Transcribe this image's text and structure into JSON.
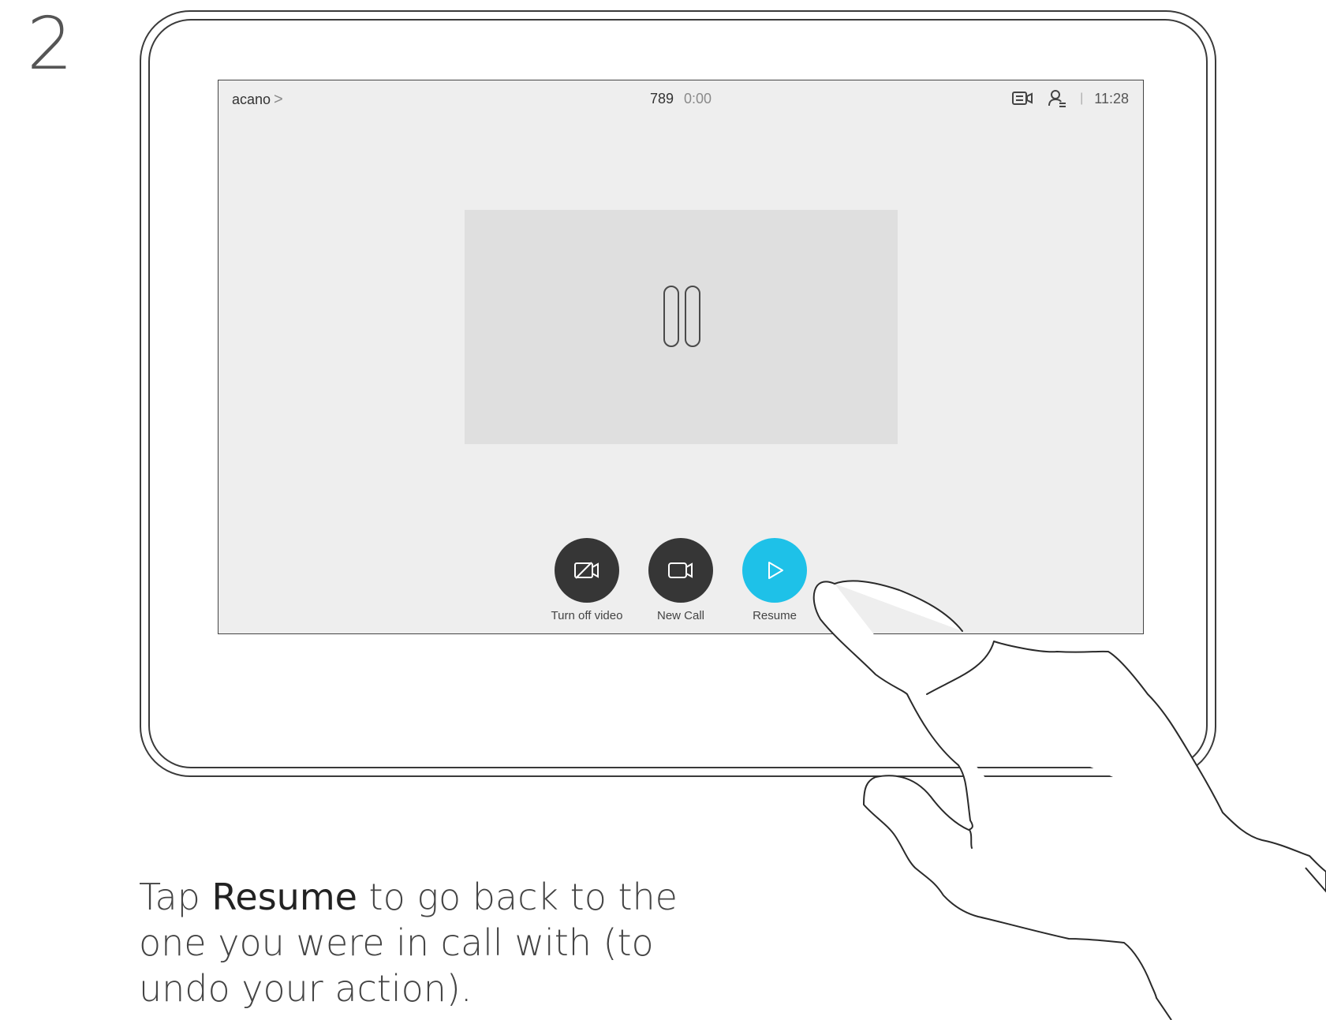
{
  "step": {
    "number": "2"
  },
  "screen": {
    "breadcrumb": {
      "label": "acano",
      "chevron": ">"
    },
    "call": {
      "number": "789",
      "duration": "0:00"
    },
    "status": {
      "separator": "|",
      "time": "11:28"
    },
    "controls": [
      {
        "label": "Turn off video",
        "icon": "video-off-icon",
        "color": "#363636"
      },
      {
        "label": "New Call",
        "icon": "video-camera-icon",
        "color": "#363636"
      },
      {
        "label": "Resume",
        "icon": "play-icon",
        "color": "#1ec1e8"
      }
    ]
  },
  "instruction": {
    "prefix": "Tap ",
    "emphasis": "Resume",
    "suffix": " to go back to the one you were in call with (to undo your action)."
  }
}
